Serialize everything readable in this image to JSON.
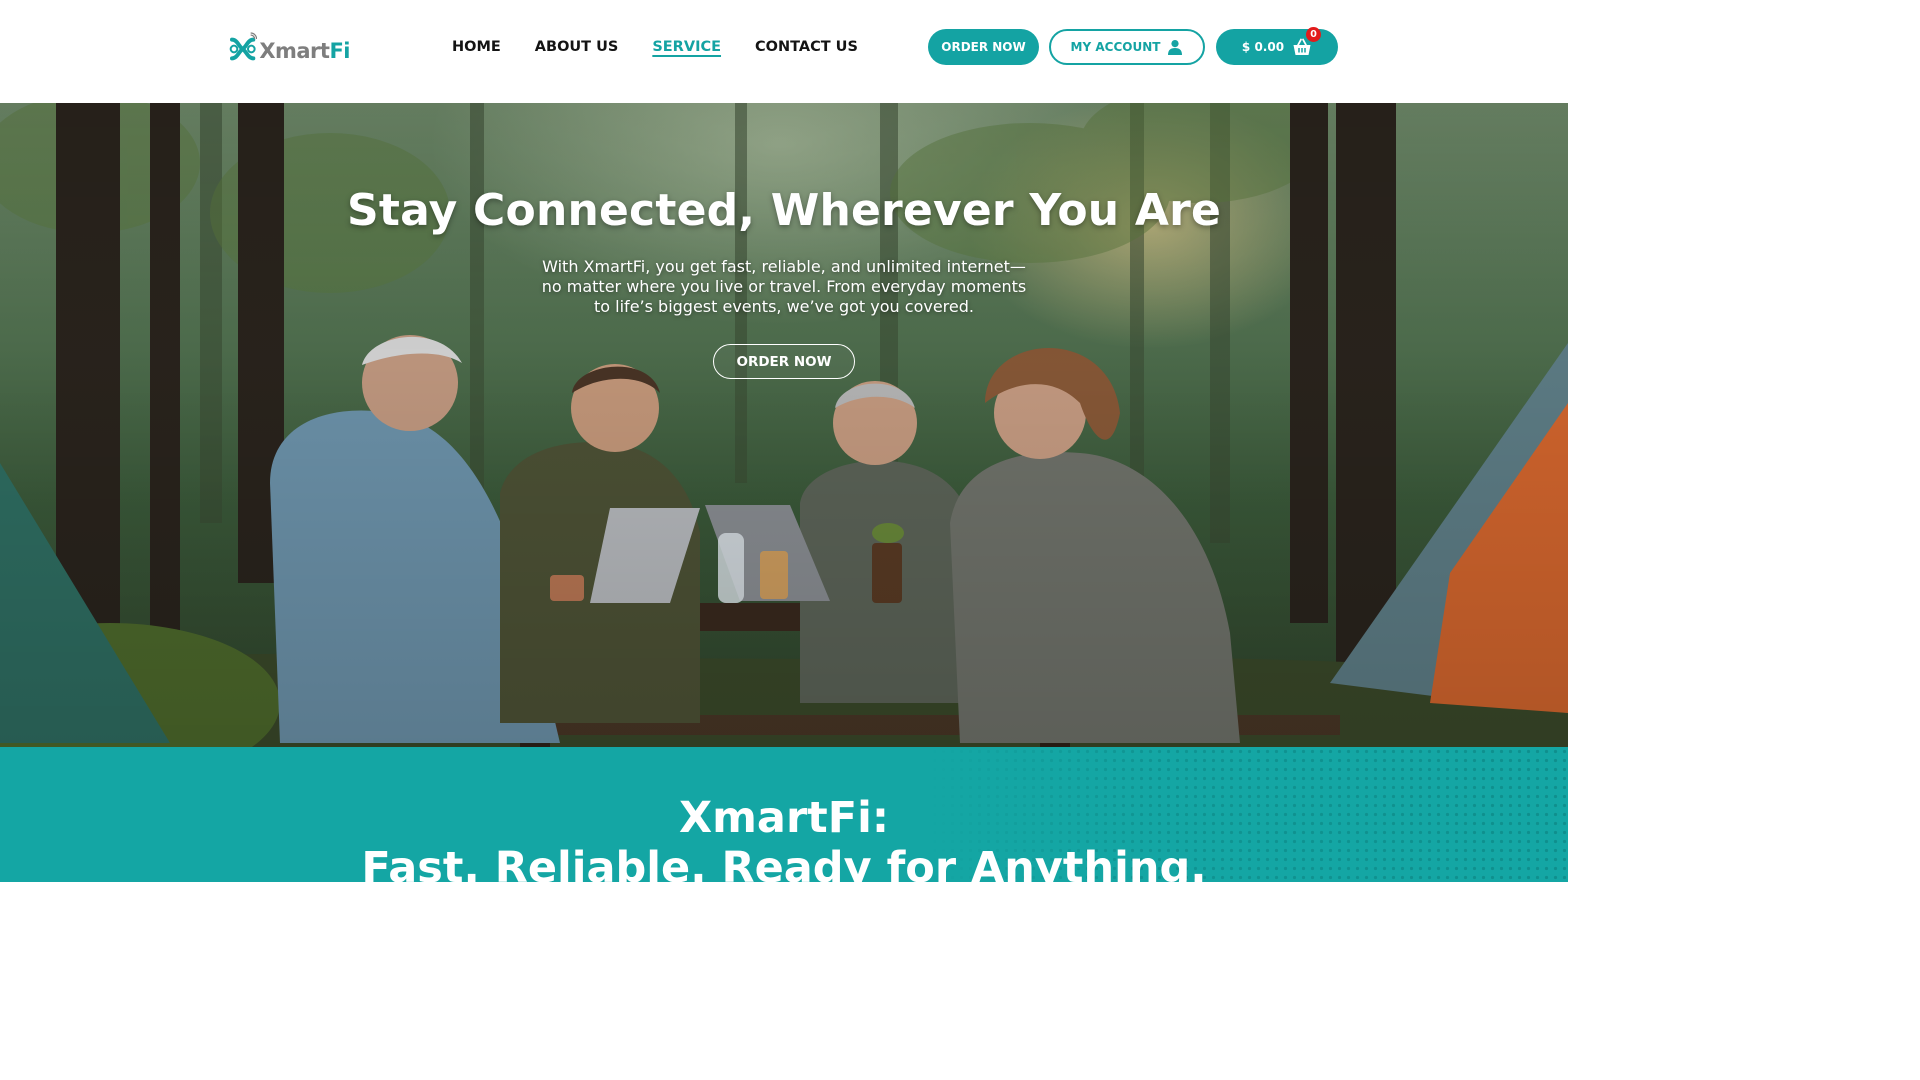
{
  "brand": {
    "name_part1": "Xmart",
    "name_part2": "Fi",
    "teal": "#14a3a3",
    "grey": "#7e7e7e"
  },
  "nav": {
    "items": [
      {
        "label": "HOME",
        "active": false
      },
      {
        "label": "ABOUT US",
        "active": false
      },
      {
        "label": "SERVICE",
        "active": true
      },
      {
        "label": "CONTACT US",
        "active": false
      }
    ]
  },
  "header_actions": {
    "order_label": "ORDER NOW",
    "account_label": "MY ACCOUNT",
    "cart_total": "$ 0.00",
    "cart_count": "0",
    "account_icon": "user-icon",
    "cart_icon": "shopping-basket-icon"
  },
  "hero": {
    "title": "Stay Connected, Wherever You Are",
    "subtitle_line1": "With XmartFi, you get fast, reliable, and unlimited internet—",
    "subtitle_line2": "no matter where you live or travel. From everyday moments",
    "subtitle_line3": "to life’s biggest events, we’ve got you covered.",
    "cta_label": "ORDER NOW"
  },
  "band": {
    "title_line1": "XmartFi:",
    "title_line2": "Fast. Reliable. Ready for Anything.",
    "color": "#14a6a4"
  }
}
